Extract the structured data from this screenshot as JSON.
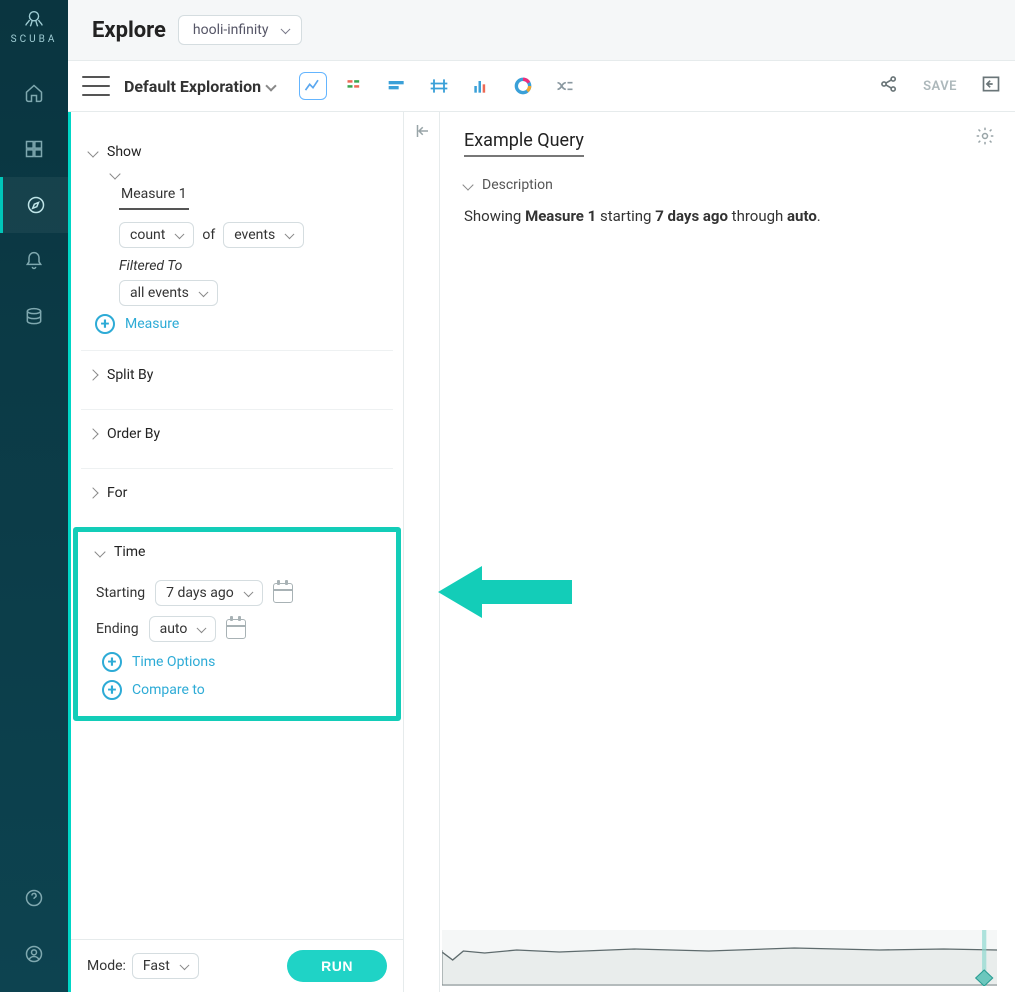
{
  "brand": {
    "name": "SCUBA"
  },
  "header": {
    "title": "Explore",
    "dataset": "hooli-infinity",
    "exploration_name": "Default Exploration",
    "save_label": "SAVE"
  },
  "panel": {
    "show": {
      "label": "Show",
      "measure_tab": "Measure 1",
      "agg": "count",
      "of_label": "of",
      "entity": "events",
      "filtered_to_label": "Filtered To",
      "filter_value": "all events",
      "add_measure_label": "Measure"
    },
    "split_by": {
      "label": "Split By"
    },
    "order_by": {
      "label": "Order By"
    },
    "for": {
      "label": "For"
    },
    "time": {
      "label": "Time",
      "starting_label": "Starting",
      "starting_value": "7 days ago",
      "ending_label": "Ending",
      "ending_value": "auto",
      "time_options_label": "Time Options",
      "compare_to_label": "Compare to"
    }
  },
  "footer": {
    "mode_label": "Mode:",
    "mode_value": "Fast",
    "run_label": "RUN"
  },
  "results": {
    "title": "Example Query",
    "description_label": "Description",
    "description_parts": {
      "p1": "Showing ",
      "b1": "Measure 1",
      "p2": " starting ",
      "b2": "7 days ago",
      "p3": " through ",
      "b3": "auto",
      "p4": "."
    }
  }
}
